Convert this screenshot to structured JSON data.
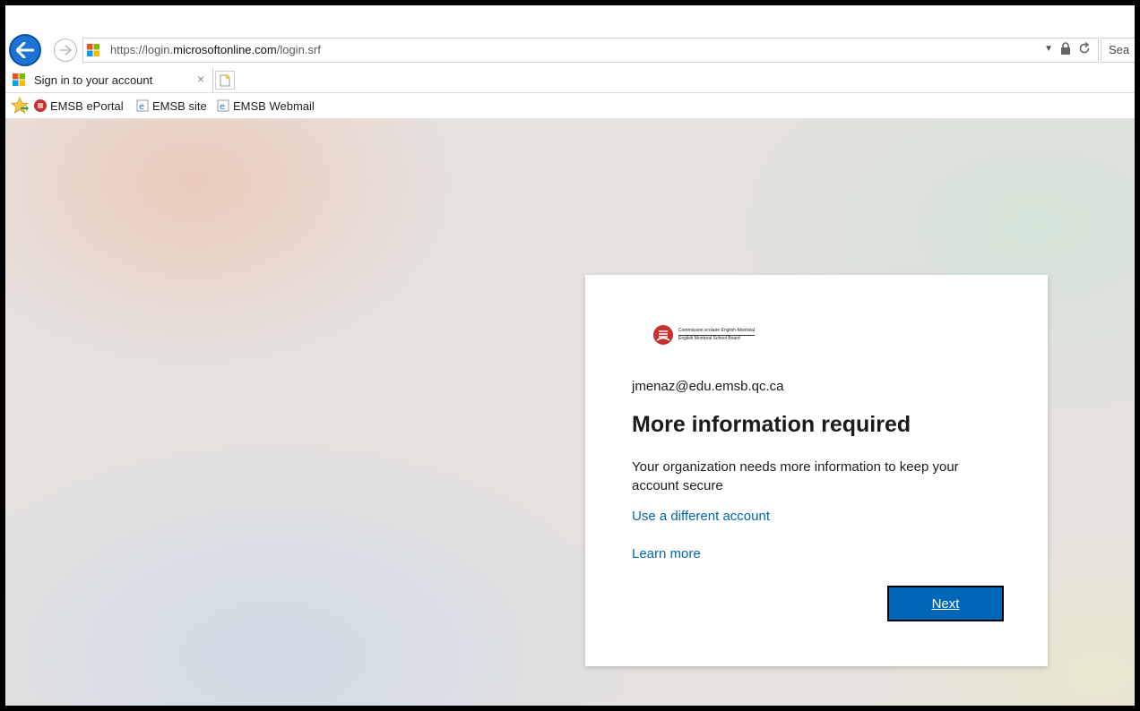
{
  "browser": {
    "address": {
      "url_prefix": "https://login.",
      "url_domain": "microsoftonline.com",
      "url_path": "/login.srf"
    },
    "search_placeholder": "Sea",
    "tab": {
      "title": "Sign in to your account",
      "close_glyph": "×"
    },
    "favorites": [
      {
        "label": "EMSB ePortal"
      },
      {
        "label": "EMSB site"
      },
      {
        "label": "EMSB Webmail"
      }
    ]
  },
  "card": {
    "logo": {
      "line1": "Commission scolaire English-Montréal",
      "line2": "English Montreal School Board"
    },
    "account": "jmenaz@edu.emsb.qc.ca",
    "title": "More information required",
    "description": "Your organization needs more information to keep your account secure",
    "use_different_account": "Use a different account",
    "learn_more": "Learn more",
    "next_label": "Next"
  },
  "colors": {
    "accent": "#0067b8",
    "back_button": "#1b73d3",
    "logo_red": "#c8302e"
  }
}
